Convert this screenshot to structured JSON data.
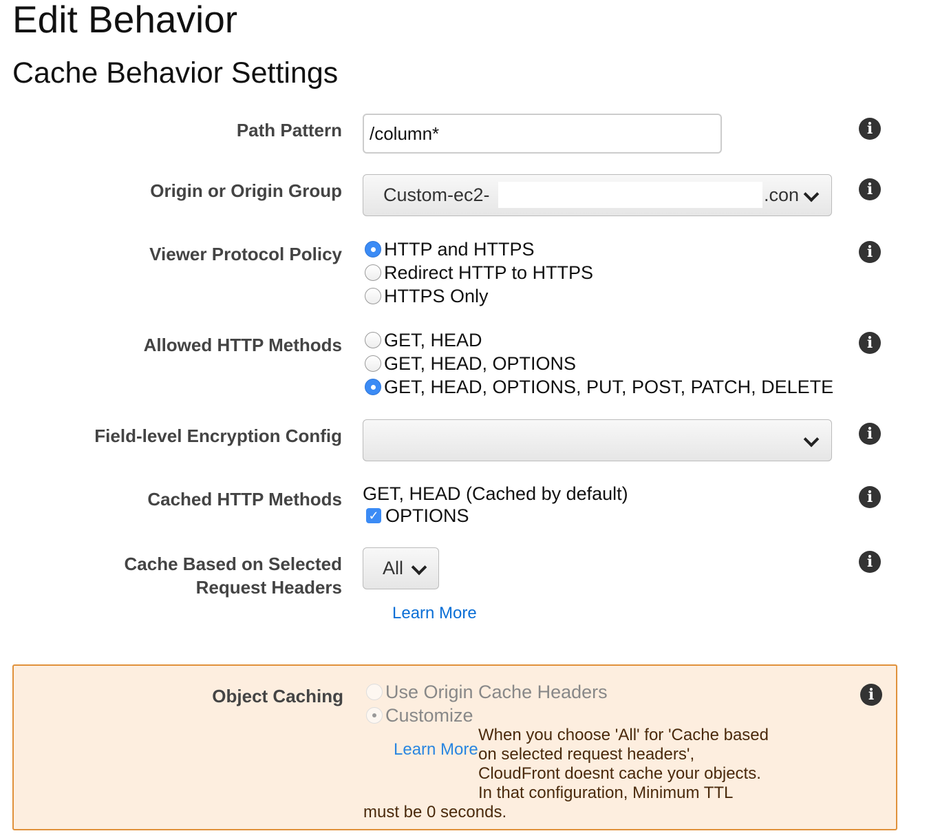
{
  "page_title": "Edit Behavior",
  "section_title": "Cache Behavior Settings",
  "fields": {
    "path_pattern": {
      "label": "Path Pattern",
      "value": "/column*"
    },
    "origin": {
      "label": "Origin or Origin Group",
      "value_prefix": "Custom-ec2-",
      "value_suffix": ".con"
    },
    "viewer_protocol": {
      "label": "Viewer Protocol Policy",
      "options": [
        "HTTP and HTTPS",
        "Redirect HTTP to HTTPS",
        "HTTPS Only"
      ],
      "selected": 0
    },
    "allowed_methods": {
      "label": "Allowed HTTP Methods",
      "options": [
        "GET, HEAD",
        "GET, HEAD, OPTIONS",
        "GET, HEAD, OPTIONS, PUT, POST, PATCH, DELETE"
      ],
      "selected": 2
    },
    "fle_config": {
      "label": "Field-level Encryption Config",
      "value": ""
    },
    "cached_methods": {
      "label": "Cached HTTP Methods",
      "default_text": "GET, HEAD (Cached by default)",
      "options_label": "OPTIONS",
      "options_checked": true
    },
    "cache_headers": {
      "label_line1": "Cache Based on Selected",
      "label_line2": "Request Headers",
      "value": "All",
      "learn_more": "Learn More"
    },
    "object_caching": {
      "label": "Object Caching",
      "options": [
        "Use Origin Cache Headers",
        "Customize"
      ],
      "selected": 1,
      "learn_more": "Learn More",
      "warning_lines": [
        "When you choose 'All' for 'Cache based",
        "on selected request headers',",
        "CloudFront doesnt cache your objects.",
        "In that configuration, Minimum TTL",
        "must be 0 seconds."
      ]
    }
  },
  "info_icon_glyph": "i"
}
